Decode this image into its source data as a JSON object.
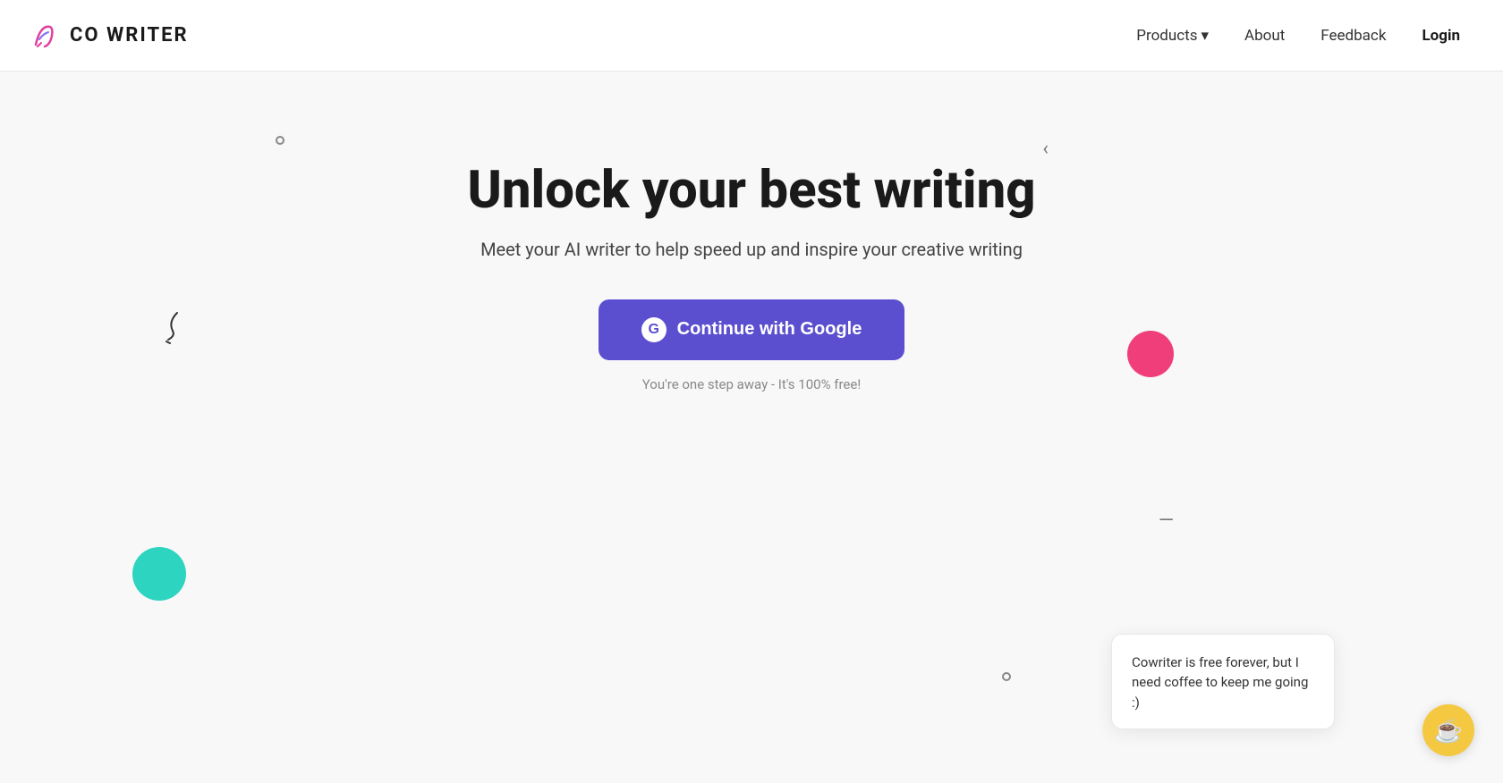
{
  "navbar": {
    "logo_text": "CO WRITER",
    "nav_products": "Products",
    "nav_about": "About",
    "nav_feedback": "Feedback",
    "nav_login": "Login"
  },
  "hero": {
    "title": "Unlock your best writing",
    "subtitle": "Meet your AI writer to help speed up and inspire your creative writing",
    "google_btn_label": "Continue with Google",
    "free_text": "You're one step away - It's 100% free!"
  },
  "chat_popup": {
    "text": "Cowriter is free forever, but I need coffee to keep me going :)"
  },
  "icons": {
    "chevron": "▾",
    "google_letter": "G",
    "coffee_emoji": "☕"
  }
}
